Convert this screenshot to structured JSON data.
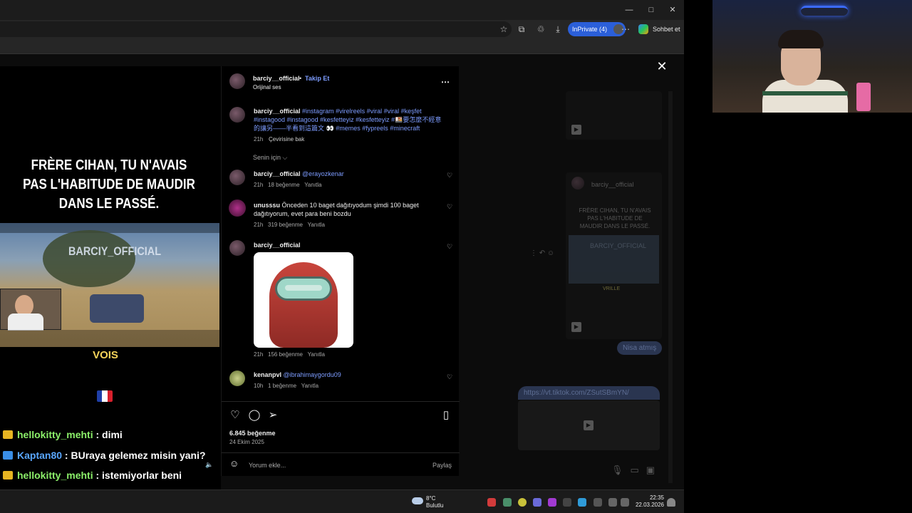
{
  "browser": {
    "inprivate_label": "InPrivate (4)",
    "copilot_label": "Sohbet et",
    "window_controls": [
      "—",
      "□",
      "✕"
    ]
  },
  "video": {
    "title": "FRÈRE CIHAN, TU N'AVAIS PAS L'HABITUDE DE MAUDIR DANS LE PASSÉ.",
    "watermark": "BARCIY_OFFICIAL",
    "caption": "VOIS"
  },
  "chat": [
    {
      "user": "hellokitty_mehti",
      "message": " : dimi",
      "badge_color": "#e6b422"
    },
    {
      "user": "Kaptan80",
      "message": " : BUraya gelemez misin yani?",
      "badge_color": "#3a8ee6"
    },
    {
      "user": "hellokitty_mehti",
      "message": " : istemiyorlar beni",
      "badge_color": "#e6b422"
    }
  ],
  "post": {
    "author": "barciy__official",
    "follow": "Takip Et",
    "separator": "•",
    "audio": "Orijinal ses",
    "caption_user": "barciy__official",
    "caption_tags": "#instagram #virelreels #viral #viral #keşfet #instagood #instagood #kesfetteyiz #kesfetteyiz #🍱要怎麼不經意的讓另——半看到這篇文 👀 #memes #fypreels #minecraft",
    "caption_time": "21h",
    "caption_translate": "Çevirisine bak",
    "for_you": "Senin için",
    "comments": [
      {
        "user": "barciy__official",
        "text": "@erayozkenar",
        "time": "21h",
        "likes": "18 beğenme",
        "reply": "Yanıtla"
      },
      {
        "user": "unusssu",
        "text": "Önceden 10 baget dağıtıyodum şimdi 100 baget dağıtıyorum, evet para beni bozdu",
        "time": "21h",
        "likes": "319 beğenme",
        "reply": "Yanıtla"
      },
      {
        "user": "barciy__official",
        "text": "",
        "time": "21h",
        "likes": "156 beğenme",
        "reply": "Yanıtla"
      },
      {
        "user": "kenanpvl",
        "text": "@ibrahimaygordu09",
        "time": "10h",
        "likes": "1 beğenme",
        "reply": "Yanıtla"
      }
    ],
    "like_count": "6.845 beğenme",
    "date": "24 Ekim 2025",
    "comment_placeholder": "Yorum ekle...",
    "share_label": "Paylaş"
  },
  "background_dm": {
    "sender": "barciy__official",
    "preview_text": "FRÈRE CIHAN, TU N'AVAIS PAS L'HABITUDE DE MAUDIR DANS LE PASSÉ.",
    "preview_label": "BARCIY_OFFICIAL",
    "preview_caption": "VRILLE",
    "sent_bubble": "Nisa atmış",
    "link": "https://vt.tiktok.com/ZSutSBmYN/"
  },
  "taskbar": {
    "weather_temp": "8°C",
    "weather_desc": "Bulutlu",
    "time": "22:35",
    "date": "22.03.2026"
  },
  "colors": {
    "accent_blue": "#2b5fd9",
    "tag_blue": "#7d9cff",
    "chat_green": "#8cf06a",
    "chat_blue": "#5aa7ff",
    "vois_yellow": "#f5d35a"
  }
}
